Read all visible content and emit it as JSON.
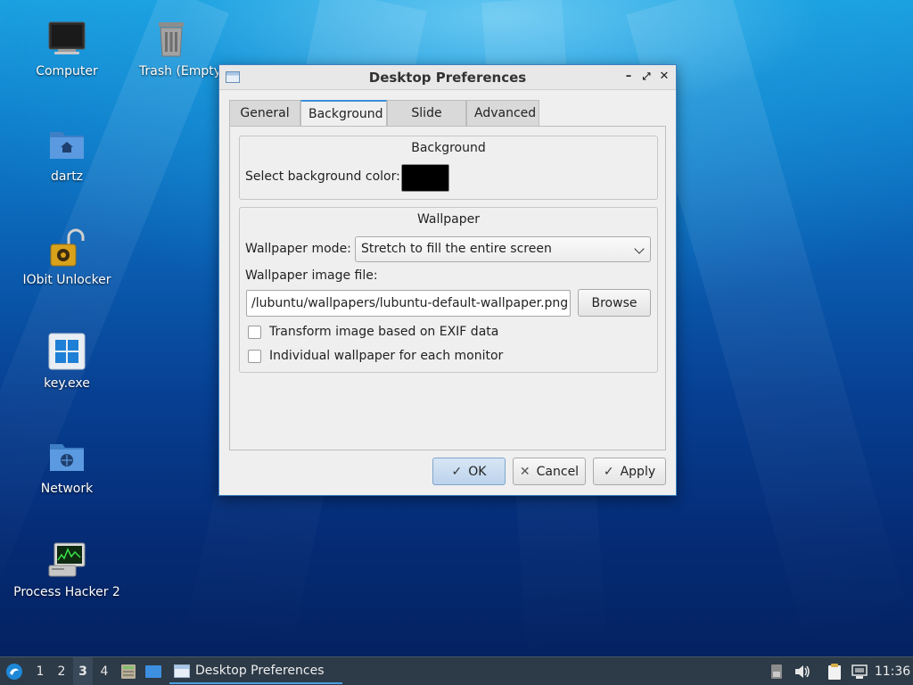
{
  "desktop": {
    "icons": [
      {
        "label": "Computer",
        "icon": "computer-monitor-icon"
      },
      {
        "label": "Trash (Empty",
        "icon": "trash-icon"
      },
      {
        "label": "dartz",
        "icon": "home-folder-icon"
      },
      {
        "label": "IObit Unlocker",
        "icon": "unlocked-padlock-icon"
      },
      {
        "label": "key.exe",
        "icon": "windows-logo-icon"
      },
      {
        "label": "Network",
        "icon": "network-folder-icon"
      },
      {
        "label": "Process Hacker 2",
        "icon": "process-hacker-icon"
      }
    ]
  },
  "dialog": {
    "title": "Desktop Preferences",
    "tabs": [
      {
        "label": "General",
        "active": false
      },
      {
        "label": "Background",
        "active": true
      },
      {
        "label": "Slide Show",
        "active": false
      },
      {
        "label": "Advanced",
        "active": false
      }
    ],
    "background_group": {
      "title": "Background",
      "color_label": "Select background color:",
      "color_value": "#000000"
    },
    "wallpaper_group": {
      "title": "Wallpaper",
      "mode_label": "Wallpaper mode:",
      "mode_value": "Stretch to fill the entire screen",
      "file_label": "Wallpaper image file:",
      "file_value": "/lubuntu/wallpapers/lubuntu-default-wallpaper.png",
      "browse_label": "Browse",
      "exif_label": "Transform image based on EXIF data",
      "exif_checked": false,
      "individual_label": "Individual wallpaper for each monitor",
      "individual_checked": false
    },
    "buttons": {
      "ok": "OK",
      "cancel": "Cancel",
      "apply": "Apply"
    }
  },
  "taskbar": {
    "workspaces": [
      "1",
      "2",
      "3",
      "4"
    ],
    "active_workspace": "3",
    "task_label": "Desktop Preferences",
    "clock": "11:36"
  }
}
